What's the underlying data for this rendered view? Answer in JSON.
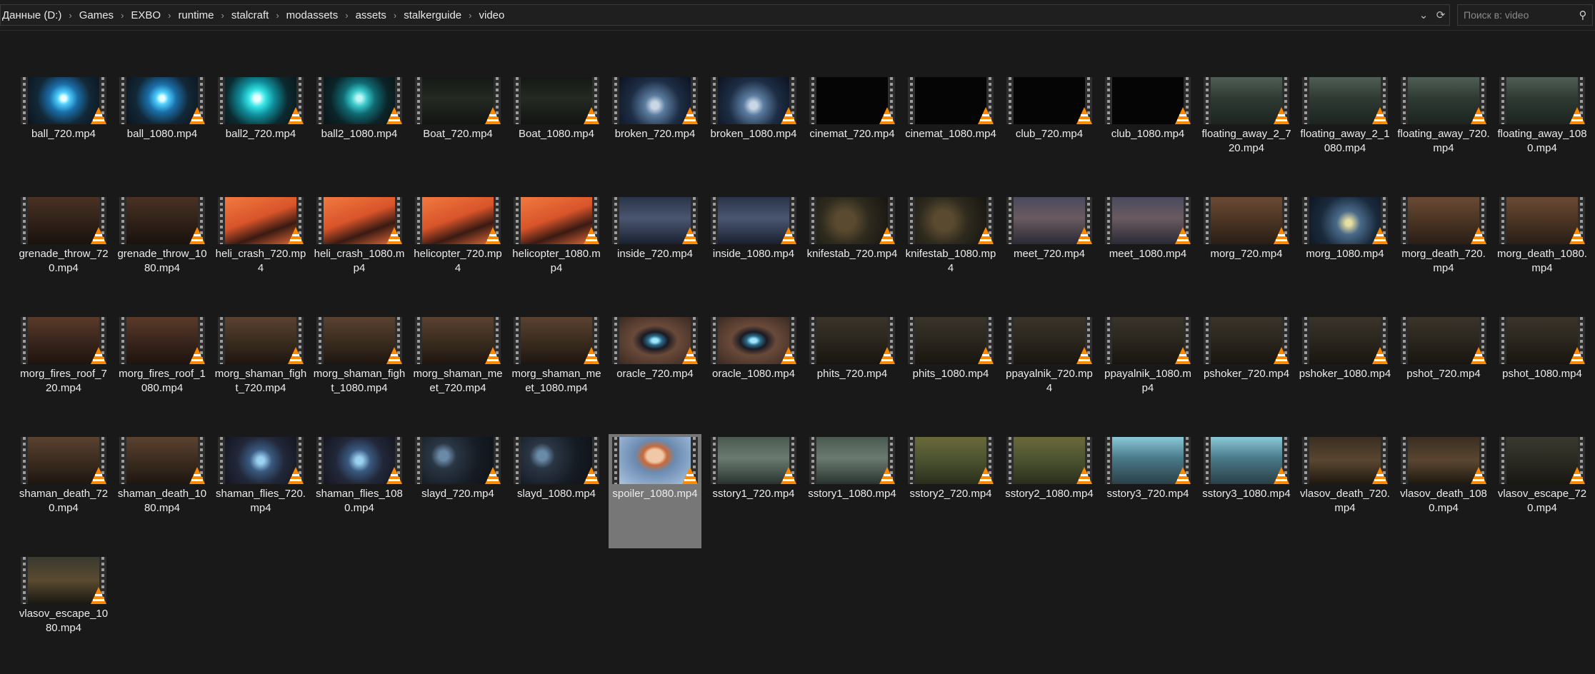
{
  "breadcrumb": [
    "Данные (D:)",
    "Games",
    "EXBO",
    "runtime",
    "stalcraft",
    "modassets",
    "assets",
    "stalkerguide",
    "video"
  ],
  "search": {
    "placeholder": "Поиск в: video"
  },
  "files": [
    {
      "name": "ball_720.mp4",
      "bg": "radial-gradient(circle at 50% 45%, #e6ffff 0 6%, #4fd0ff 14%, #1a6ea8 32%, #122838 60%, #0d141c 100%)"
    },
    {
      "name": "ball_1080.mp4",
      "bg": "radial-gradient(circle at 50% 45%, #e6ffff 0 6%, #4fd0ff 14%, #1a6ea8 32%, #122838 60%, #0d141c 100%)"
    },
    {
      "name": "ball2_720.mp4",
      "bg": "radial-gradient(circle at 45% 45%, #e9ffff 0 6%, #35e5e6 18%, #0f8f9c 36%, #0b2a30 65%, #0a1518 100%)"
    },
    {
      "name": "ball2_1080.mp4",
      "bg": "radial-gradient(circle at 50% 45%, #bff6f4 0 6%, #39c7c9 18%, #106a73 36%, #0b2428 65%, #0a1416 100%)"
    },
    {
      "name": "Boat_720.mp4",
      "bg": "linear-gradient(180deg, #151815 0%, #242a22 45%, #121412 100%)"
    },
    {
      "name": "Boat_1080.mp4",
      "bg": "linear-gradient(180deg, #151815 0%, #242a22 45%, #121412 100%)"
    },
    {
      "name": "broken_720.mp4",
      "bg": "radial-gradient(circle at 50% 60%, #c8d6e6 0 8%, #5b7ca0 22%, #1d2d44 55%, #0c1320 100%)"
    },
    {
      "name": "broken_1080.mp4",
      "bg": "radial-gradient(circle at 50% 60%, #c8d6e6 0 8%, #5b7ca0 22%, #1d2d44 55%, #0c1320 100%)"
    },
    {
      "name": "cinemat_720.mp4",
      "bg": "#050505"
    },
    {
      "name": "cinemat_1080.mp4",
      "bg": "#050505"
    },
    {
      "name": "club_720.mp4",
      "bg": "#050505"
    },
    {
      "name": "club_1080.mp4",
      "bg": "#050505"
    },
    {
      "name": "floating_away_2_720.mp4",
      "bg": "linear-gradient(180deg, #4f5f55 0%, #2e3a33 45%, #1c2420 100%)"
    },
    {
      "name": "floating_away_2_1080.mp4",
      "bg": "linear-gradient(180deg, #4f5f55 0%, #2e3a33 45%, #1c2420 100%)"
    },
    {
      "name": "floating_away_720.mp4",
      "bg": "linear-gradient(180deg, #4f5f55 0%, #2e3a33 45%, #1c2420 100%)"
    },
    {
      "name": "floating_away_1080.mp4",
      "bg": "linear-gradient(180deg, #4f5f55 0%, #2e3a33 45%, #1c2420 100%)"
    },
    {
      "name": "grenade_throw_720.mp4",
      "bg": "linear-gradient(180deg, #4a3224 0%, #2e2018 55%, #1a120e 100%)"
    },
    {
      "name": "grenade_throw_1080.mp4",
      "bg": "linear-gradient(180deg, #4a3224 0%, #2e2018 55%, #1a120e 100%)"
    },
    {
      "name": "heli_crash_720.mp4",
      "bg": "linear-gradient(160deg, #f07a40 0%, #d9542a 45%, #3a1a12 70%, #e06a3a 100%)"
    },
    {
      "name": "heli_crash_1080.mp4",
      "bg": "linear-gradient(160deg, #f07a40 0%, #d9542a 45%, #3a1a12 70%, #e06a3a 100%)"
    },
    {
      "name": "helicopter_720.mp4",
      "bg": "linear-gradient(160deg, #f07a40 0%, #d9542a 45%, #3a1a12 70%, #e06a3a 100%)"
    },
    {
      "name": "helicopter_1080.mp4",
      "bg": "linear-gradient(160deg, #f07a40 0%, #d9542a 45%, #3a1a12 70%, #e06a3a 100%)"
    },
    {
      "name": "inside_720.mp4",
      "bg": "linear-gradient(180deg, #2a3448 0%, #4a5670 45%, #1a2030 100%)"
    },
    {
      "name": "inside_1080.mp4",
      "bg": "linear-gradient(180deg, #2a3448 0%, #4a5670 45%, #1a2030 100%)"
    },
    {
      "name": "knifestab_720.mp4",
      "bg": "radial-gradient(circle at 40% 50%, #5a4a30 0 20%, #2e2a1e 50%, #161510 100%)"
    },
    {
      "name": "knifestab_1080.mp4",
      "bg": "radial-gradient(circle at 40% 50%, #5a4a30 0 20%, #2e2a1e 50%, #161510 100%)"
    },
    {
      "name": "meet_720.mp4",
      "bg": "linear-gradient(180deg, #4a4a5e 0%, #6a5a60 45%, #2a2a36 100%)"
    },
    {
      "name": "meet_1080.mp4",
      "bg": "linear-gradient(180deg, #4a4a5e 0%, #6a5a60 45%, #2a2a36 100%)"
    },
    {
      "name": "morg_720.mp4",
      "bg": "linear-gradient(180deg, #6a4a34 0%, #4a3424 50%, #2a1e16 100%)"
    },
    {
      "name": "morg_1080.mp4",
      "bg": "radial-gradient(circle at 55% 55%, #e8e0a0 0 6%, #4a6a8a 25%, #1a2a3c 60%, #0e1622 100%)"
    },
    {
      "name": "morg_death_720.mp4",
      "bg": "linear-gradient(180deg, #6a4a34 0%, #4a3424 50%, #2a1e16 100%)"
    },
    {
      "name": "morg_death_1080.mp4",
      "bg": "linear-gradient(180deg, #6a4a34 0%, #4a3424 50%, #2a1e16 100%)"
    },
    {
      "name": "morg_fires_roof_720.mp4",
      "bg": "linear-gradient(180deg, #5a3a2a 0%, #3a261c 50%, #1e140e 100%)"
    },
    {
      "name": "morg_fires_roof_1080.mp4",
      "bg": "linear-gradient(180deg, #5a3a2a 0%, #3a261c 50%, #1e140e 100%)"
    },
    {
      "name": "morg_shaman_fight_720.mp4",
      "bg": "linear-gradient(180deg, #5a4230 0%, #3c2c20 50%, #1e1610 100%)"
    },
    {
      "name": "morg_shaman_fight_1080.mp4",
      "bg": "linear-gradient(180deg, #5a4230 0%, #3c2c20 50%, #1e1610 100%)"
    },
    {
      "name": "morg_shaman_meet_720.mp4",
      "bg": "linear-gradient(180deg, #5a4230 0%, #3c2c20 50%, #1e1610 100%)"
    },
    {
      "name": "morg_shaman_meet_1080.mp4",
      "bg": "linear-gradient(180deg, #5a4230 0%, #3c2c20 50%, #1e1610 100%)"
    },
    {
      "name": "oracle_720.mp4",
      "bg": "radial-gradient(ellipse at 50% 50%, #9fe6ff 0 6%, #2a6a8a 14%, #1a1a22 26%, #6a4a3a 45%, #3a2a22 100%)"
    },
    {
      "name": "oracle_1080.mp4",
      "bg": "radial-gradient(ellipse at 50% 50%, #9fe6ff 0 6%, #2a6a8a 14%, #1a1a22 26%, #6a4a3a 45%, #3a2a22 100%)"
    },
    {
      "name": "phits_720.mp4",
      "bg": "linear-gradient(180deg, #3a342a 0%, #2a261e 50%, #18160f 100%)"
    },
    {
      "name": "phits_1080.mp4",
      "bg": "linear-gradient(180deg, #3a342a 0%, #2a261e 50%, #18160f 100%)"
    },
    {
      "name": "ppayalnik_720.mp4",
      "bg": "linear-gradient(180deg, #3a342a 0%, #2a261e 50%, #18160f 100%)"
    },
    {
      "name": "ppayalnik_1080.mp4",
      "bg": "linear-gradient(180deg, #3a342a 0%, #2a261e 50%, #18160f 100%)"
    },
    {
      "name": "pshoker_720.mp4",
      "bg": "linear-gradient(180deg, #3a342a 0%, #2a261e 50%, #18160f 100%)"
    },
    {
      "name": "pshoker_1080.mp4",
      "bg": "linear-gradient(180deg, #3a342a 0%, #2a261e 50%, #18160f 100%)"
    },
    {
      "name": "pshot_720.mp4",
      "bg": "linear-gradient(180deg, #3a342a 0%, #2a261e 50%, #18160f 100%)"
    },
    {
      "name": "pshot_1080.mp4",
      "bg": "linear-gradient(180deg, #3a342a 0%, #2a261e 50%, #18160f 100%)"
    },
    {
      "name": "shaman_death_720.mp4",
      "bg": "linear-gradient(180deg, #5a4230 0%, #3c2c20 50%, #1e1610 100%)"
    },
    {
      "name": "shaman_death_1080.mp4",
      "bg": "linear-gradient(180deg, #5a4230 0%, #3c2c20 50%, #1e1610 100%)"
    },
    {
      "name": "shaman_flies_720.mp4",
      "bg": "radial-gradient(circle at 50% 50%, #9ad0f0 0 8%, #3a5a80 26%, #22283a 55%, #141620 100%)"
    },
    {
      "name": "shaman_flies_1080.mp4",
      "bg": "radial-gradient(circle at 50% 50%, #9ad0f0 0 8%, #3a5a80 26%, #22283a 55%, #141620 100%)"
    },
    {
      "name": "slayd_720.mp4",
      "bg": "radial-gradient(circle at 30% 40%, #6a8aa8 0 8%, #2a3644 22%, #161c24 60%, #0e1218 100%)"
    },
    {
      "name": "slayd_1080.mp4",
      "bg": "radial-gradient(circle at 30% 40%, #6a8aa8 0 8%, #2a3644 22%, #161c24 60%, #0e1218 100%)"
    },
    {
      "name": "spoiler_1080.mp4",
      "bg": "radial-gradient(ellipse at 50% 40%, #f0c8a8 0 16%, #c86a3a 24%, #6a8ab0 40%, #aac4e0 100%)"
    },
    {
      "name": "sstory1_720.mp4",
      "bg": "linear-gradient(180deg, #4a5a50 0%, #6a7a70 45%, #2a3430 100%)"
    },
    {
      "name": "sstory1_1080.mp4",
      "bg": "linear-gradient(180deg, #4a5a50 0%, #6a7a70 45%, #2a3430 100%)"
    },
    {
      "name": "sstory2_720.mp4",
      "bg": "linear-gradient(180deg, #6a6a3a 0%, #4a5230 50%, #2a2e1c 100%)"
    },
    {
      "name": "sstory2_1080.mp4",
      "bg": "linear-gradient(180deg, #6a6a3a 0%, #4a5230 50%, #2a2e1c 100%)"
    },
    {
      "name": "sstory3_720.mp4",
      "bg": "linear-gradient(180deg, #8ac8d8 0%, #4a7a88 45%, #2a4048 100%)"
    },
    {
      "name": "sstory3_1080.mp4",
      "bg": "linear-gradient(180deg, #8ac8d8 0%, #4a7a88 45%, #2a4048 100%)"
    },
    {
      "name": "vlasov_death_720.mp4",
      "bg": "linear-gradient(180deg, #3a2e22 0%, #5a4630 50%, #1e1810 100%)"
    },
    {
      "name": "vlasov_death_1080.mp4",
      "bg": "linear-gradient(180deg, #3a2e22 0%, #5a4630 50%, #1e1810 100%)"
    },
    {
      "name": "vlasov_escape_720.mp4",
      "bg": "linear-gradient(180deg, #3a3a30 0%, #2a2a22 50%, #181812 100%)"
    },
    {
      "name": "vlasov_escape_1080.mp4",
      "bg": "linear-gradient(180deg, #3a3a30 0%, #5a4a30 50%, #181812 100%)"
    }
  ],
  "selected_file": "spoiler_1080.mp4"
}
